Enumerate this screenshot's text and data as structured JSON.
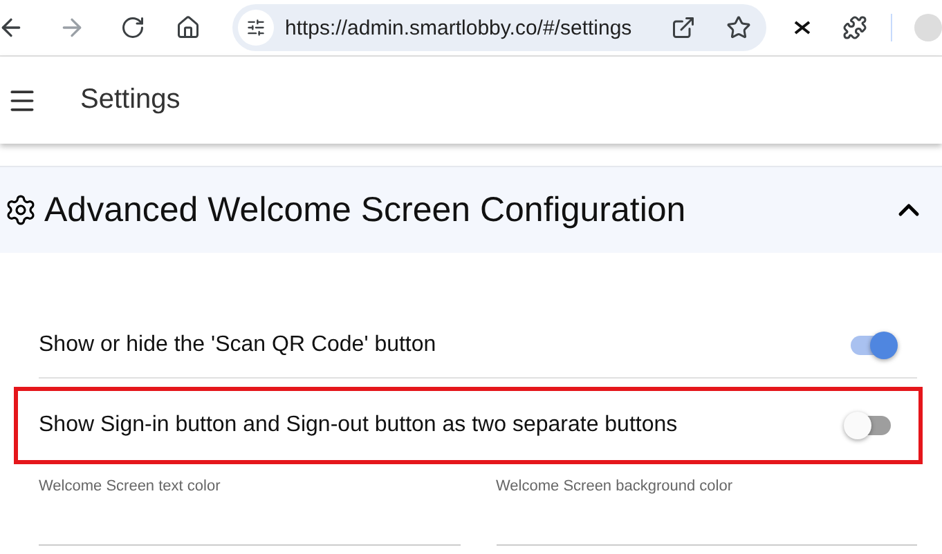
{
  "browser": {
    "url": "https://admin.smartlobby.co/#/settings"
  },
  "app_bar": {
    "title": "Settings"
  },
  "section": {
    "title": "Advanced Welcome Screen Configuration",
    "expanded": true
  },
  "toggles": [
    {
      "label": "Show or hide the 'Scan QR Code' button",
      "on": true,
      "highlighted": false
    },
    {
      "label": "Show Sign-in button and Sign-out button as two separate buttons",
      "on": false,
      "highlighted": true
    }
  ],
  "color_fields": [
    {
      "label": "Welcome Screen text color"
    },
    {
      "label": "Welcome Screen background color"
    }
  ]
}
